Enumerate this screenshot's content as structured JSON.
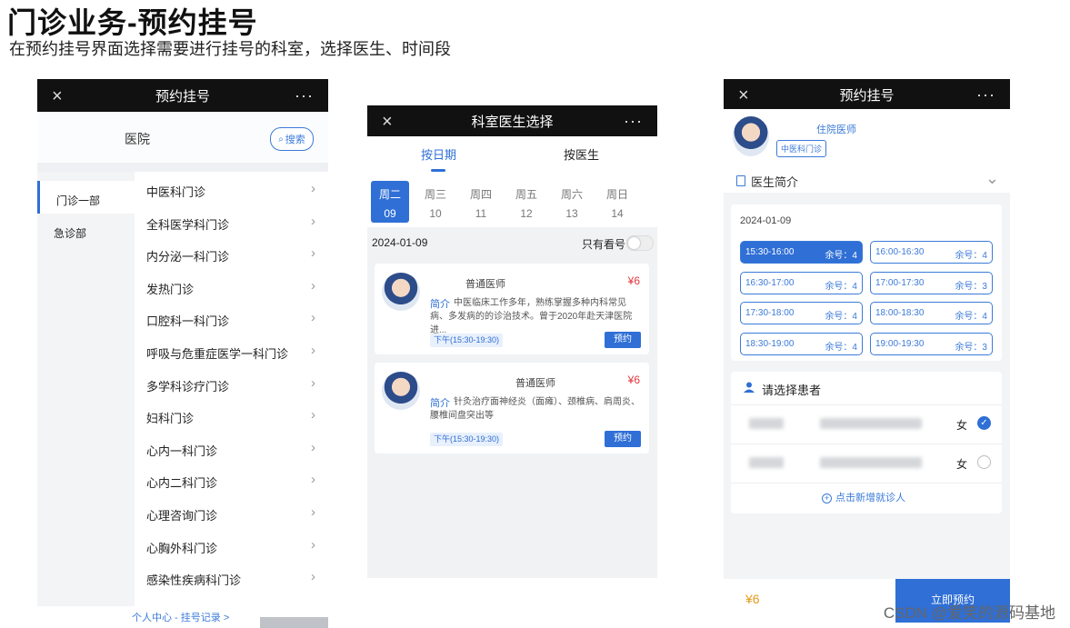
{
  "page": {
    "title": "门诊业务-预约挂号",
    "subtitle": "在预约挂号界面选择需要进行挂号的科室，选择医生、时间段",
    "watermark": "CSDN @爱笑的源码基地"
  },
  "screen1": {
    "title": "预约挂号",
    "close_icon": "×",
    "more_icon": "···",
    "hospital_label": "医院",
    "search_label": "搜索",
    "left_items": [
      "门诊一部",
      "急诊部"
    ],
    "departments": [
      "中医科门诊",
      "全科医学科门诊",
      "内分泌一科门诊",
      "发热门诊",
      "口腔科一科门诊",
      "呼吸与危重症医学一科门诊",
      "多学科诊疗门诊",
      "妇科门诊",
      "心内一科门诊",
      "心内二科门诊",
      "心理咨询门诊",
      "心胸外科门诊",
      "感染性疾病科门诊"
    ],
    "chevron": "›",
    "footer_link": "个人中心 - 挂号记录 >"
  },
  "screen2": {
    "title": "科室医生选择",
    "close_icon": "×",
    "more_icon": "···",
    "tab_by_date": "按日期",
    "tab_by_doctor": "按医生",
    "days": [
      {
        "week": "周二",
        "date": "09"
      },
      {
        "week": "周三",
        "date": "10"
      },
      {
        "week": "周四",
        "date": "11"
      },
      {
        "week": "周五",
        "date": "12"
      },
      {
        "week": "周六",
        "date": "13"
      },
      {
        "week": "周日",
        "date": "14"
      },
      {
        "week": "周",
        "date": ""
      }
    ],
    "date": "2024-01-09",
    "only_available": "只有看号",
    "doctors": [
      {
        "role": "普通医师",
        "price": "¥6",
        "intro_label": "简介",
        "intro": "中医临床工作多年，熟练掌握多种内科常见病、多发病的的诊治技术。曾于2020年赴天津医院进...",
        "slot": "下午(15:30-19:30)",
        "book": "预约"
      },
      {
        "role": "普通医师",
        "price": "¥6",
        "intro_label": "简介",
        "intro": "针灸治疗面神经炎（面瘫）、颈椎病、肩周炎、腰椎间盘突出等",
        "slot": "下午(15:30-19:30)",
        "book": "预约"
      }
    ]
  },
  "screen3": {
    "title": "预约挂号",
    "close_icon": "×",
    "more_icon": "···",
    "doctor_role": "住院医师",
    "doctor_dept": "中医科门诊",
    "intro_label": "医生简介",
    "expand_icon": "⌄",
    "date": "2024-01-09",
    "slots": [
      {
        "time": "15:30-16:00",
        "remain": "余号：4"
      },
      {
        "time": "16:00-16:30",
        "remain": "余号：4"
      },
      {
        "time": "16:30-17:00",
        "remain": "余号：4"
      },
      {
        "time": "17:00-17:30",
        "remain": "余号：3"
      },
      {
        "time": "17:30-18:00",
        "remain": "余号：4"
      },
      {
        "time": "18:00-18:30",
        "remain": "余号：4"
      },
      {
        "time": "18:30-19:00",
        "remain": "余号：4"
      },
      {
        "time": "19:00-19:30",
        "remain": "余号：3"
      }
    ],
    "selected_slot": "15:30-16:00",
    "patient_header": "请选择患者",
    "patients": [
      {
        "sex": "女",
        "checked": true
      },
      {
        "sex": "女",
        "checked": false
      }
    ],
    "check_mark": "✓",
    "add_patient": "点击新增就诊人",
    "add_icon": "+",
    "price": "¥6",
    "confirm": "立即预约"
  },
  "colors": {
    "accent": "#2f6fd6",
    "price": "#e0393e",
    "topbar": "#111111"
  }
}
